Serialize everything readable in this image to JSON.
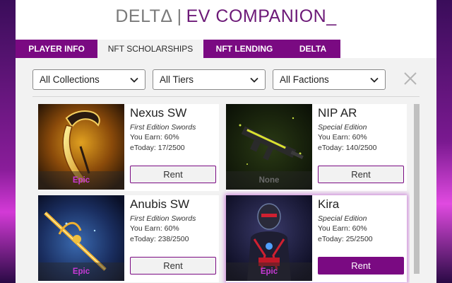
{
  "header": {
    "brand_left": "DELTΔ",
    "separator": "|",
    "brand_right": "EV COMPANION_"
  },
  "tabs": [
    {
      "label": "PLAYER INFO",
      "active": false
    },
    {
      "label": "NFT SCHOLARSHIPS",
      "active": true
    },
    {
      "label": "NFT LENDING",
      "active": false
    },
    {
      "label": "DELTA",
      "active": false
    }
  ],
  "filters": {
    "collections": "All Collections",
    "tiers": "All Tiers",
    "factions": "All Factions"
  },
  "cards": [
    {
      "name": "Nexus SW",
      "edition": "First Edition Swords",
      "earn": "You Earn: 60%",
      "etoday": "eToday: 17/2500",
      "rarity": "Epic",
      "rent_label": "Rent",
      "rent_style": "secondary"
    },
    {
      "name": "NIP AR",
      "edition": "Special Edition",
      "earn": "You Earn: 60%",
      "etoday": "eToday: 140/2500",
      "rarity": "None",
      "rent_label": "Rent",
      "rent_style": "secondary"
    },
    {
      "name": "Anubis SW",
      "edition": "First Edition Swords",
      "earn": "You Earn: 60%",
      "etoday": "eToday: 238/2500",
      "rarity": "Epic",
      "rent_label": "Rent",
      "rent_style": "secondary"
    },
    {
      "name": "Kira",
      "edition": "Special Edition",
      "earn": "You Earn: 60%",
      "etoday": "eToday: 25/2500",
      "rarity": "Epic",
      "rent_label": "Rent",
      "rent_style": "primary"
    }
  ],
  "icons": {
    "close": "close-icon",
    "dropdown": "chevron-down-icon"
  },
  "colors": {
    "brand_purple": "#7a0a82",
    "epic": "#c83ad6",
    "brand_gray": "#7a7a7a"
  }
}
